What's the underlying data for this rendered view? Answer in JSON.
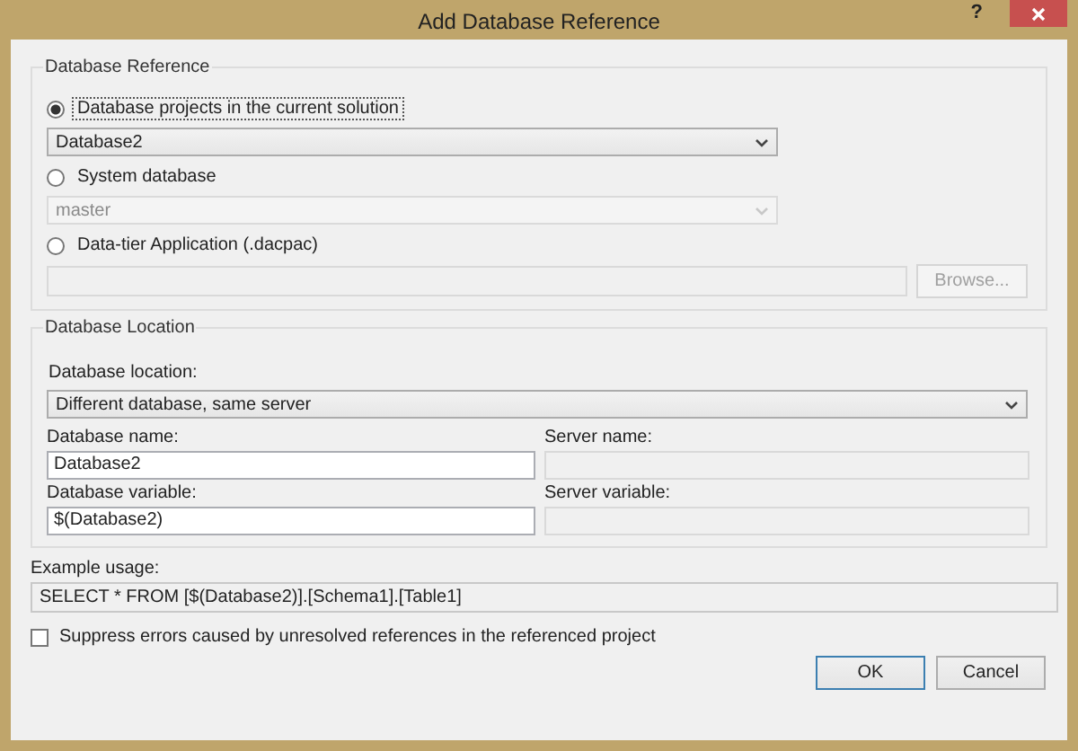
{
  "window": {
    "title": "Add Database Reference",
    "help": "?"
  },
  "reference_group": {
    "title": "Database Reference",
    "options": [
      {
        "label": "Database projects in the current solution",
        "selected": true,
        "kind": "dropdown",
        "value": "Database2",
        "disabled": false
      },
      {
        "label": "System database",
        "selected": false,
        "kind": "dropdown",
        "value": "master",
        "disabled": true
      },
      {
        "label": "Data-tier Application (.dacpac)",
        "selected": false,
        "kind": "file",
        "disabled": true,
        "button": "Browse..."
      }
    ]
  },
  "location_group": {
    "title": "Database Location",
    "location_label": "Database location:",
    "location_value": "Different database, same server",
    "fields": [
      {
        "label": "Database name:",
        "value": "Database2",
        "disabled": false
      },
      {
        "label": "Server name:",
        "disabled": true
      },
      {
        "label": "Database variable:",
        "value": "$(Database2)",
        "disabled": false
      },
      {
        "label": "Server variable:",
        "disabled": true
      }
    ]
  },
  "example": {
    "label": "Example usage:",
    "value": "SELECT * FROM [$(Database2)].[Schema1].[Table1]"
  },
  "suppress": {
    "label": "Suppress errors caused by unresolved references in the referenced project",
    "checked": false
  },
  "buttons": [
    {
      "label": "OK",
      "default": true
    },
    {
      "label": "Cancel",
      "default": false
    }
  ]
}
